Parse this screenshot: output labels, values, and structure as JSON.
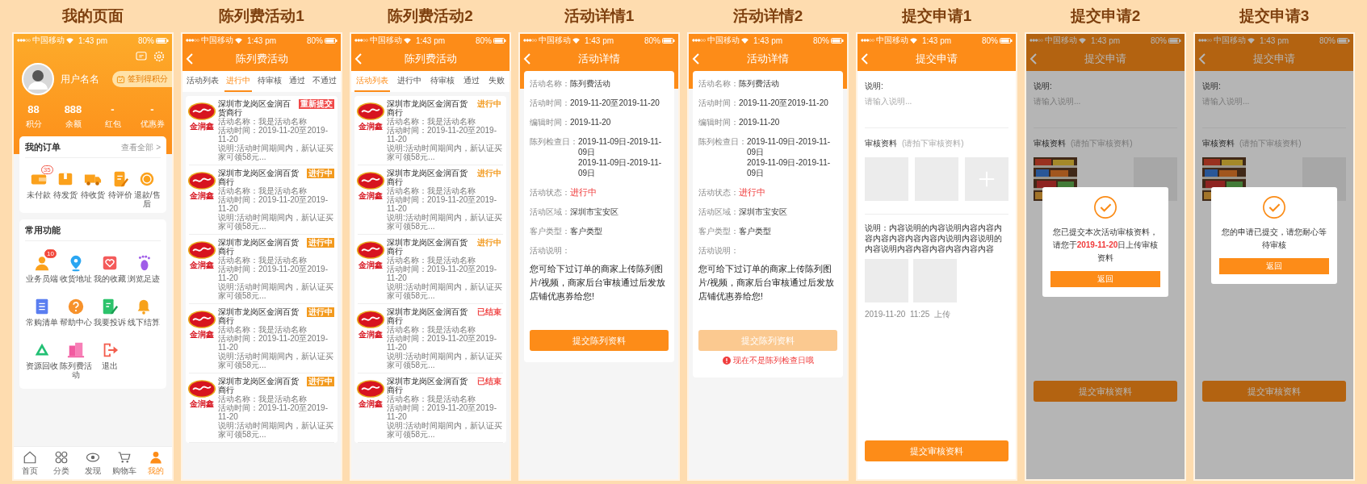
{
  "screens": [
    {
      "kind": "profile",
      "title": "我的页面",
      "status_bar": {
        "carrier": "中国移动",
        "time": "1:43 pm",
        "battery": "80%"
      },
      "user": {
        "name": "用户名名"
      },
      "checkin_button": "签到得积分",
      "stats": [
        {
          "value": "88",
          "label": "积分"
        },
        {
          "value": "888",
          "label": "余额"
        },
        {
          "value": "-",
          "label": "红包"
        },
        {
          "value": "-",
          "label": "优惠券"
        }
      ],
      "orders": {
        "title": "我的订单",
        "link": "查看全部 >",
        "items": [
          {
            "label": "未付款",
            "badge": "35"
          },
          {
            "label": "待发货"
          },
          {
            "label": "待收货"
          },
          {
            "label": "待评价"
          },
          {
            "label": "退款/售后"
          }
        ]
      },
      "functions": {
        "title": "常用功能",
        "items": [
          {
            "label": "业务员端",
            "badge": "10"
          },
          {
            "label": "收货地址"
          },
          {
            "label": "我的收藏"
          },
          {
            "label": "浏览足迹"
          },
          {
            "label": "常购清单"
          },
          {
            "label": "帮助中心"
          },
          {
            "label": "我要投诉"
          },
          {
            "label": "线下结算"
          },
          {
            "label": "资源回收"
          },
          {
            "label": "陈列费活动"
          },
          {
            "label": "退出"
          }
        ]
      },
      "tab_bar": [
        {
          "label": "首页",
          "selected": false
        },
        {
          "label": "分类",
          "selected": false
        },
        {
          "label": "发现",
          "selected": false
        },
        {
          "label": "购物车",
          "selected": false
        },
        {
          "label": "我的",
          "selected": true
        }
      ]
    },
    {
      "kind": "list",
      "title": "陈列费活动1",
      "status_bar": {
        "carrier": "中国移动",
        "time": "1:43 pm",
        "battery": "80%"
      },
      "nav_title": "陈列费活动",
      "filled_badges": true,
      "tabs": [
        {
          "label": "活动列表",
          "selected": false
        },
        {
          "label": "进行中",
          "selected": true
        },
        {
          "label": "待审核",
          "selected": false
        },
        {
          "label": "通过",
          "selected": false
        },
        {
          "label": "不通过",
          "selected": false
        }
      ],
      "items": [
        {
          "logo_text": "金润鑫",
          "shop": "深圳市龙岗区金润百货商行",
          "name": "活动名称：我是活动名称",
          "time": "活动时间：2019-11-20至2019-11-20",
          "description": "说明:活动时间期间内，新认证买家可领58元...",
          "status": "重新提交",
          "color": "#f04848"
        },
        {
          "logo_text": "金润鑫",
          "shop": "深圳市龙岗区金润百货商行",
          "name": "活动名称：我是活动名称",
          "time": "活动时间：2019-11-20至2019-11-20",
          "description": "说明:活动时间期间内，新认证买家可领58元...",
          "status": "进行中",
          "color": "#f39a1e"
        },
        {
          "logo_text": "金润鑫",
          "shop": "深圳市龙岗区金润百货商行",
          "name": "活动名称：我是活动名称",
          "time": "活动时间：2019-11-20至2019-11-20",
          "description": "说明:活动时间期间内，新认证买家可领58元...",
          "status": "进行中",
          "color": "#f39a1e"
        },
        {
          "logo_text": "金润鑫",
          "shop": "深圳市龙岗区金润百货商行",
          "name": "活动名称：我是活动名称",
          "time": "活动时间：2019-11-20至2019-11-20",
          "description": "说明:活动时间期间内，新认证买家可领58元...",
          "status": "进行中",
          "color": "#f39a1e"
        },
        {
          "logo_text": "金润鑫",
          "shop": "深圳市龙岗区金润百货商行",
          "name": "活动名称：我是活动名称",
          "time": "活动时间：2019-11-20至2019-11-20",
          "description": "说明:活动时间期间内，新认证买家可领58元...",
          "status": "进行中",
          "color": "#f39a1e"
        }
      ]
    },
    {
      "kind": "list",
      "title": "陈列费活动2",
      "status_bar": {
        "carrier": "中国移动",
        "time": "1:43 pm",
        "battery": "80%"
      },
      "nav_title": "陈列费活动",
      "filled_badges": false,
      "tabs": [
        {
          "label": "活动列表",
          "selected": true
        },
        {
          "label": "进行中",
          "selected": false
        },
        {
          "label": "待审核",
          "selected": false
        },
        {
          "label": "通过",
          "selected": false
        },
        {
          "label": "失败",
          "selected": false
        }
      ],
      "items": [
        {
          "logo_text": "金润鑫",
          "shop": "深圳市龙岗区金润百货商行",
          "name": "活动名称：我是活动名称",
          "time": "活动时间：2019-11-20至2019-11-20",
          "description": "说明:活动时间期间内，新认证买家可领58元...",
          "status": "进行中",
          "color": "#f39a1e"
        },
        {
          "logo_text": "金润鑫",
          "shop": "深圳市龙岗区金润百货商行",
          "name": "活动名称：我是活动名称",
          "time": "活动时间：2019-11-20至2019-11-20",
          "description": "说明:活动时间期间内，新认证买家可领58元...",
          "status": "进行中",
          "color": "#f39a1e"
        },
        {
          "logo_text": "金润鑫",
          "shop": "深圳市龙岗区金润百货商行",
          "name": "活动名称：我是活动名称",
          "time": "活动时间：2019-11-20至2019-11-20",
          "description": "说明:活动时间期间内，新认证买家可领58元...",
          "status": "进行中",
          "color": "#f39a1e"
        },
        {
          "logo_text": "金润鑫",
          "shop": "深圳市龙岗区金润百货商行",
          "name": "活动名称：我是活动名称",
          "time": "活动时间：2019-11-20至2019-11-20",
          "description": "说明:活动时间期间内，新认证买家可领58元...",
          "status": "已结束",
          "color": "#f04848"
        },
        {
          "logo_text": "金润鑫",
          "shop": "深圳市龙岗区金润百货商行",
          "name": "活动名称：我是活动名称",
          "time": "活动时间：2019-11-20至2019-11-20",
          "description": "说明:活动时间期间内，新认证买家可领58元...",
          "status": "已结束",
          "color": "#f04848"
        }
      ]
    },
    {
      "kind": "detail",
      "title": "活动详情1",
      "status_bar": {
        "carrier": "中国移动",
        "time": "1:43 pm",
        "battery": "80%"
      },
      "nav_title": "活动详情",
      "fields": [
        {
          "label": "活动名称：",
          "values": [
            "陈列费活动"
          ],
          "highlight": false
        },
        {
          "label": "活动时间：",
          "values": [
            "2019-11-20至2019-11-20"
          ],
          "highlight": false
        },
        {
          "label": "编辑时间：",
          "values": [
            "2019-11-20"
          ],
          "highlight": false
        },
        {
          "label": "陈列检查日：",
          "values": [
            "2019-11-09日-2019-11-09日",
            "2019-11-09日-2019-11-09日"
          ],
          "highlight": false
        },
        {
          "label": "活动状态：",
          "values": [
            "进行中"
          ],
          "highlight": true
        },
        {
          "label": "活动区域：",
          "values": [
            "深圳市宝安区"
          ],
          "highlight": false
        },
        {
          "label": "客户类型：",
          "values": [
            "客户类型"
          ],
          "highlight": false
        }
      ],
      "description_label": "活动说明：",
      "description": "您可给下过订单的商家上传陈列图片/视频，商家后台审核通过后发放店铺优惠券给您!",
      "button": {
        "label": "提交陈列资料",
        "disabled": false
      }
    },
    {
      "kind": "detail",
      "title": "活动详情2",
      "status_bar": {
        "carrier": "中国移动",
        "time": "1:43 pm",
        "battery": "80%"
      },
      "nav_title": "活动详情",
      "fields": [
        {
          "label": "活动名称：",
          "values": [
            "陈列费活动"
          ],
          "highlight": false
        },
        {
          "label": "活动时间：",
          "values": [
            "2019-11-20至2019-11-20"
          ],
          "highlight": false
        },
        {
          "label": "编辑时间：",
          "values": [
            "2019-11-20"
          ],
          "highlight": false
        },
        {
          "label": "陈列检查日：",
          "values": [
            "2019-11-09日-2019-11-09日",
            "2019-11-09日-2019-11-09日"
          ],
          "highlight": false
        },
        {
          "label": "活动状态：",
          "values": [
            "进行中"
          ],
          "highlight": true
        },
        {
          "label": "活动区域：",
          "values": [
            "深圳市宝安区"
          ],
          "highlight": false
        },
        {
          "label": "客户类型：",
          "values": [
            "客户类型"
          ],
          "highlight": false
        }
      ],
      "description_label": "活动说明：",
      "description": "您可给下过订单的商家上传陈列图片/视频，商家后台审核通过后发放店铺优惠券给您!",
      "button": {
        "label": "提交陈列资料",
        "disabled": true
      },
      "error": "现在不是陈列检查日哦"
    },
    {
      "kind": "submit",
      "title": "提交申请1",
      "status_bar": {
        "carrier": "中国移动",
        "time": "1:43 pm",
        "battery": "80%"
      },
      "nav_title": "提交申请",
      "note_label": "说明:",
      "note_placeholder": "请输入说明...",
      "materials_label": "审核资料",
      "materials_hint": "(请拍下审核资料)",
      "photos": [
        {
          "kind": "blank"
        },
        {
          "kind": "blank"
        },
        {
          "kind": "add"
        }
      ],
      "record": {
        "text": "说明：内容说明的内容说明内容内容内容内容内容内容内容内说明内容说明的内容说明内容内容内容内容内容内容",
        "photos": [
          {
            "kind": "blank"
          },
          {
            "kind": "blank"
          }
        ],
        "time": "2019-11-20  11:25  上传"
      },
      "button": {
        "label": "提交审核资料",
        "disabled": false
      },
      "dimmed": false
    },
    {
      "kind": "submit",
      "title": "提交申请2",
      "status_bar": {
        "carrier": "中国移动",
        "time": "1:43 pm",
        "battery": "80%"
      },
      "nav_title": "提交申请",
      "note_label": "说明:",
      "note_placeholder": "请输入说明...",
      "materials_label": "审核资料",
      "materials_hint": "(请拍下审核资料)",
      "photos": [
        {
          "kind": "picture"
        },
        {
          "kind": "blank"
        }
      ],
      "button": {
        "label": "提交审核资料",
        "disabled": false
      },
      "dimmed": true,
      "dialog": {
        "message": [
          {
            "text": "您已提交本次活动审核资料，请您于",
            "highlight": false
          },
          {
            "text": "2019-11-20",
            "highlight": true
          },
          {
            "text": "日上传审核资料",
            "highlight": false
          }
        ],
        "button": "返回"
      }
    },
    {
      "kind": "submit",
      "title": "提交申请3",
      "status_bar": {
        "carrier": "中国移动",
        "time": "1:43 pm",
        "battery": "80%"
      },
      "nav_title": "提交申请",
      "note_label": "说明:",
      "note_placeholder": "请输入说明...",
      "materials_label": "审核资料",
      "materials_hint": "(请拍下审核资料)",
      "photos": [
        {
          "kind": "picture"
        },
        {
          "kind": "blank"
        }
      ],
      "button": {
        "label": "提交审核资料",
        "disabled": false
      },
      "dimmed": true,
      "dialog": {
        "message": [
          {
            "text": "您的申请已提交，请您耐心等待审核",
            "highlight": false
          }
        ],
        "button": "返回"
      }
    }
  ]
}
